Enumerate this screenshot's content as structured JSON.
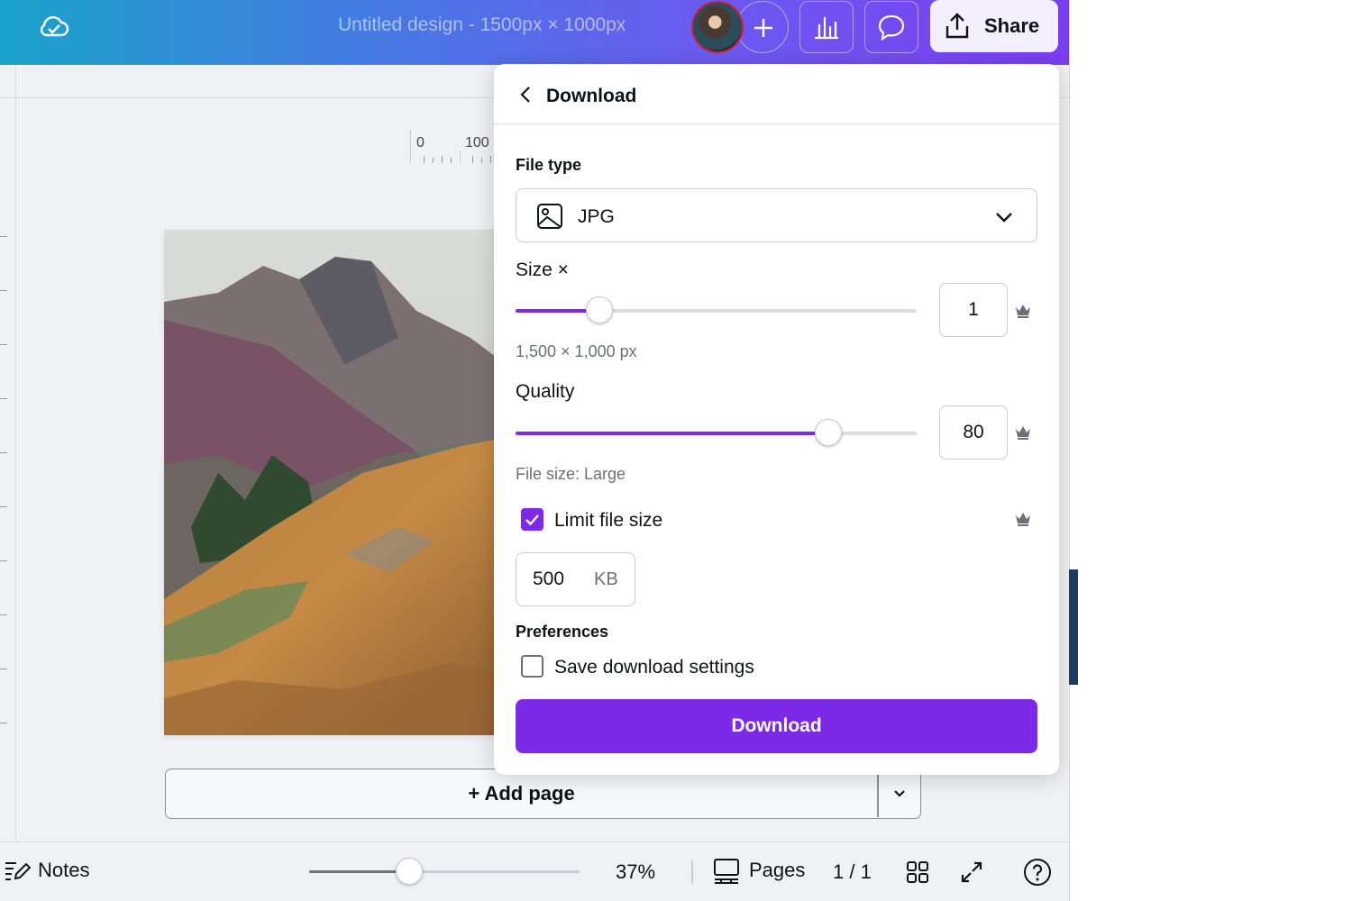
{
  "topbar": {
    "document_title": "Untitled design - 1500px × 1000px",
    "share_label": "Share",
    "icons": [
      "cloud-check-icon",
      "plus-icon",
      "analytics-icon",
      "comment-icon",
      "share-upload-icon"
    ]
  },
  "ruler": {
    "marks": [
      "0",
      "100"
    ]
  },
  "canvas": {
    "add_page_label": "+ Add page"
  },
  "bottombar": {
    "notes_label": "Notes",
    "zoom_percent": "37%",
    "zoom_value": 37,
    "pages_label": "Pages",
    "page_count": "1 / 1"
  },
  "download_panel": {
    "title": "Download",
    "file_type_label": "File type",
    "file_type_value": "JPG",
    "size_label": "Size ×",
    "size_value": "1",
    "size_slider_fraction": 0.21,
    "dimensions": "1,500 × 1,000 px",
    "quality_label": "Quality",
    "quality_value": "80",
    "quality_slider_fraction": 0.78,
    "file_size_text": "File size: Large",
    "limit_file_size_label": "Limit file size",
    "limit_file_size_checked": true,
    "limit_value": "500",
    "limit_unit": "KB",
    "preferences_label": "Preferences",
    "save_settings_label": "Save download settings",
    "save_settings_checked": false,
    "download_button_label": "Download"
  },
  "colors": {
    "accent": "#7d2ae8",
    "topbar_gradient_start": "#1aa3c9",
    "topbar_gradient_end": "#7b3df0"
  }
}
